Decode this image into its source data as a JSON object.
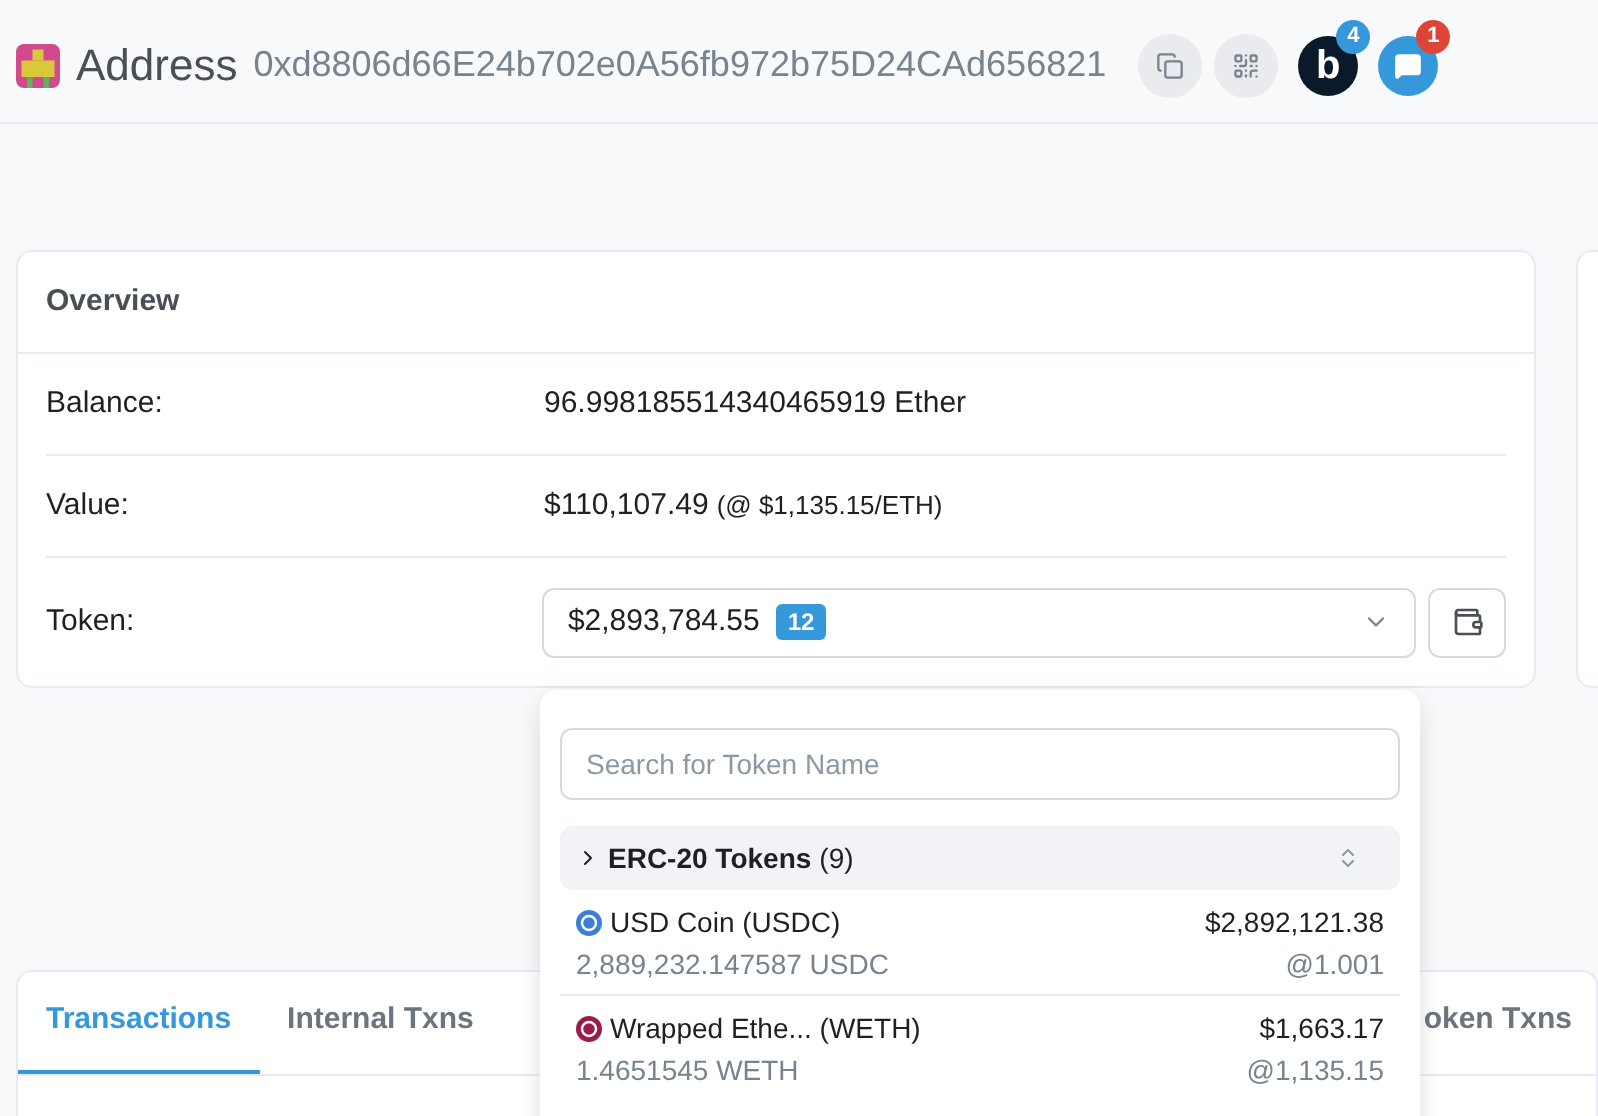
{
  "header": {
    "title": "Address",
    "address": "0xd8806d66E24b702e0A56fb972b75D24CAd656821",
    "badges": [
      {
        "kind": "blockscan",
        "count": "4",
        "label": "b"
      },
      {
        "kind": "chat",
        "count": "1"
      }
    ]
  },
  "overview": {
    "title": "Overview",
    "rows": [
      {
        "label": "Balance:",
        "value": "96.998185514340465919 Ether"
      },
      {
        "label": "Value:",
        "value": "$110,107.49",
        "note": "(@ $1,135.15/ETH)"
      }
    ],
    "token": {
      "label": "Token:",
      "value": "$2,893,784.55",
      "count": "12"
    }
  },
  "dropdown": {
    "search": {
      "placeholder": "Search for Token Name"
    },
    "group": {
      "title": "ERC-20 Tokens",
      "count": "(9)",
      "expanded": false
    },
    "items": [
      {
        "name": "USD Coin (USDC)",
        "amount": "2,889,232.147587 USDC",
        "value": "$2,892,121.38",
        "rate": "@1.001",
        "color": "#3d7fd6"
      },
      {
        "name": "Wrapped Ethe... (WETH)",
        "amount": "1.4651545 WETH",
        "value": "$1,663.17",
        "rate": "@1,135.15",
        "color": "#9b1c4a"
      }
    ]
  },
  "tabs": [
    {
      "label": "Transactions",
      "selected": true
    },
    {
      "label": "Internal Txns",
      "selected": false
    },
    {
      "label": "oken Txns",
      "selected": false
    }
  ]
}
